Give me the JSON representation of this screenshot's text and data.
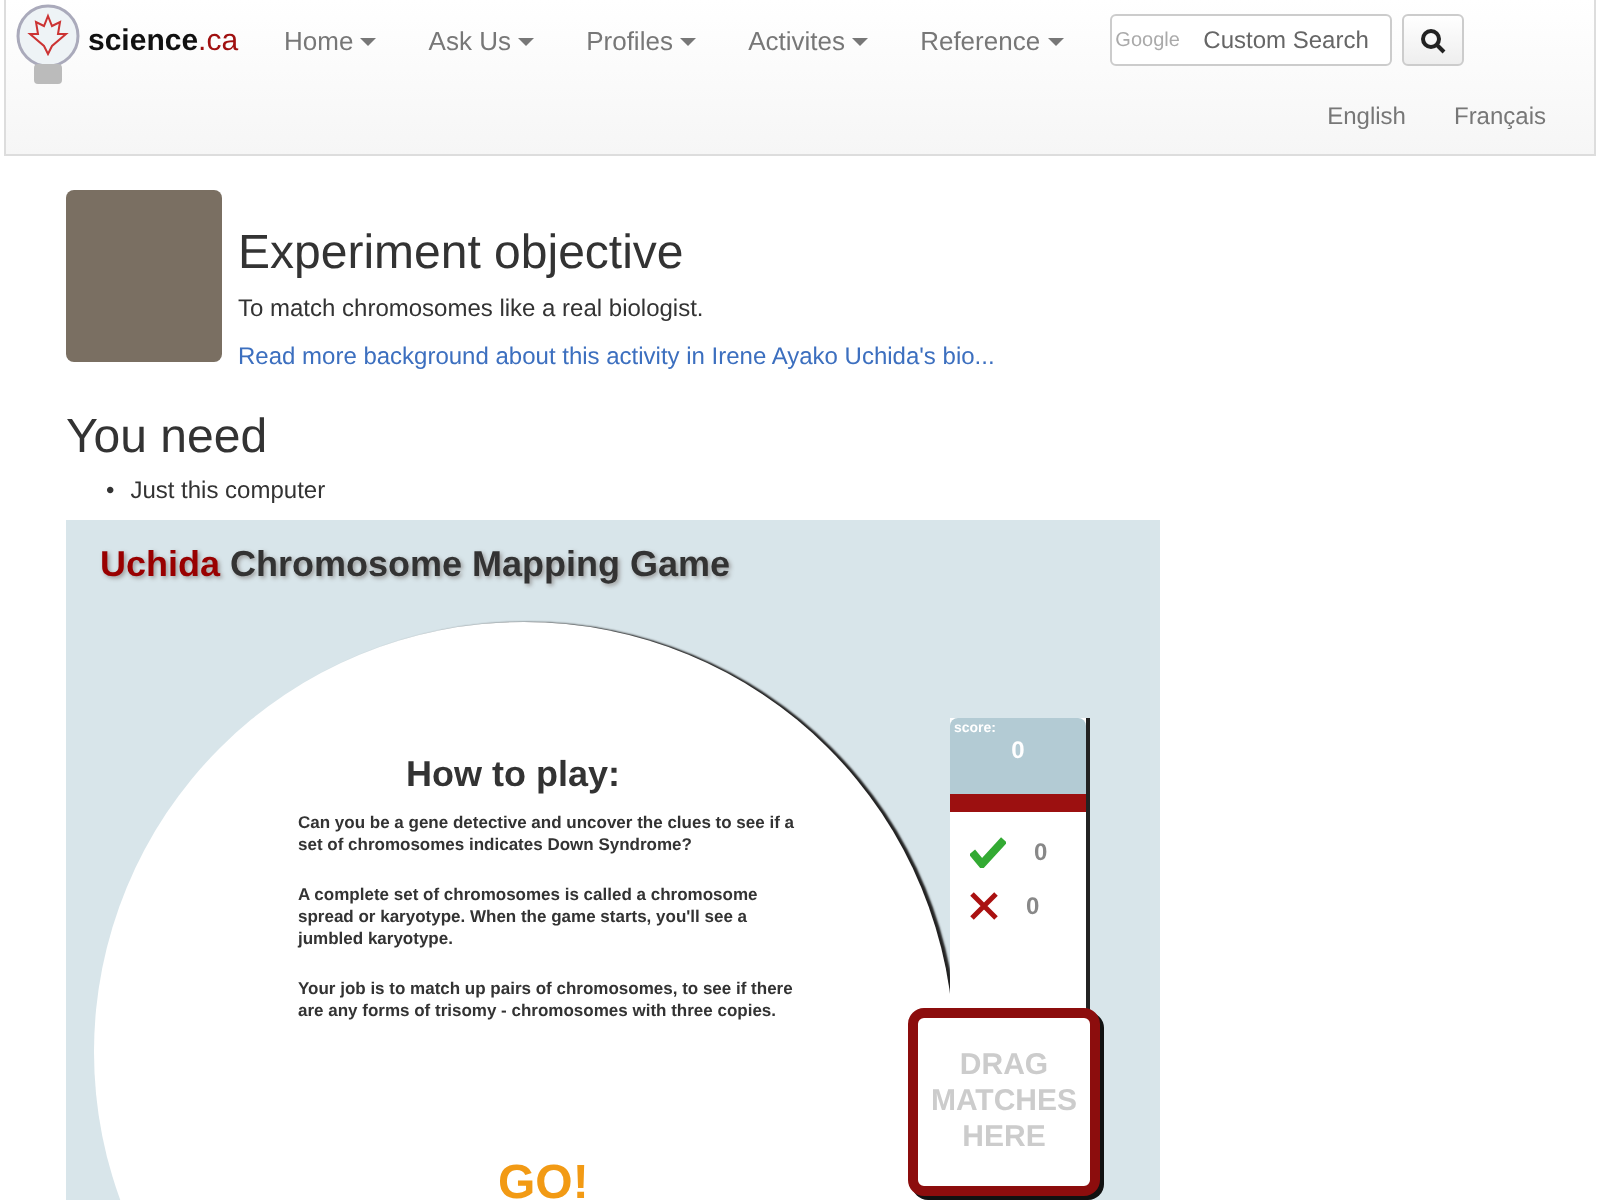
{
  "brand": {
    "name": "science",
    "suffix": ".ca"
  },
  "nav": [
    {
      "label": "Home"
    },
    {
      "label": "Ask Us"
    },
    {
      "label": "Profiles"
    },
    {
      "label": "Activites"
    },
    {
      "label": "Reference"
    }
  ],
  "search": {
    "brand": "Google",
    "placeholder": "Custom Search"
  },
  "languages": [
    {
      "label": "English"
    },
    {
      "label": "Français"
    }
  ],
  "objective": {
    "title": "Experiment objective",
    "text": "To match chromosomes like a real biologist.",
    "link": "Read more background about this activity in Irene Ayako Uchida's bio..."
  },
  "need": {
    "title": "You need",
    "items": [
      {
        "bullet": "•",
        "text": "Just this computer"
      }
    ]
  },
  "game": {
    "title_name": "Uchida",
    "title_rest": "Chromosome Mapping Game",
    "heading": "How to play:",
    "paragraphs": [
      "Can you be a gene detective and uncover the clues to see if a set of chromosomes indicates Down Syndrome?",
      "A complete set of chromosomes is called a chromosome spread or karyotype. When the game starts, you'll see a jumbled karyotype.",
      "Your job is to match up pairs of chromosomes, to see if there are any forms of trisomy - chromosomes with three copies."
    ],
    "go": "GO!",
    "score_label": "score:",
    "score": "0",
    "correct": "0",
    "wrong": "0",
    "drop_zone": "DRAG MATCHES HERE"
  }
}
